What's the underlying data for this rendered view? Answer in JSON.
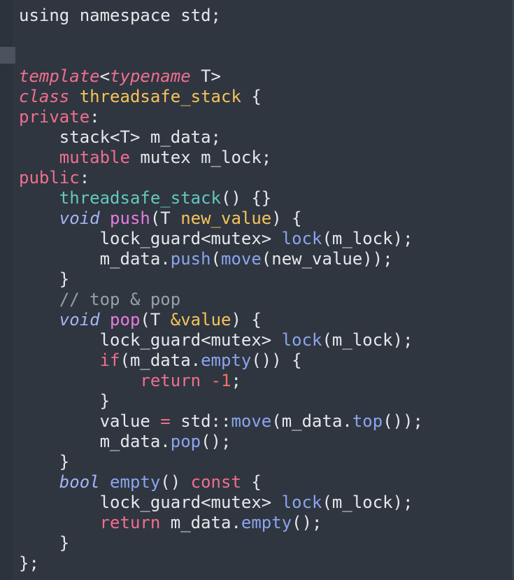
{
  "editor": {
    "colors": {
      "background": "#2f3640",
      "plain": "#e6e8ea",
      "keyword": "#f06f8d",
      "type": "#a5b5f7",
      "entity": "#f6c35a",
      "constructor": "#63c9bd",
      "function": "#e97be0",
      "method": "#8ca4ef",
      "number": "#ff6f5e",
      "comment": "#97a0aa"
    },
    "lines": [
      [
        {
          "t": "using namespace std;",
          "c": "plain"
        }
      ],
      [],
      [],
      [
        {
          "t": "template",
          "c": "storage"
        },
        {
          "t": "<",
          "c": "plain"
        },
        {
          "t": "typename",
          "c": "storage"
        },
        {
          "t": " T>",
          "c": "plain"
        }
      ],
      [
        {
          "t": "class",
          "c": "storage"
        },
        {
          "t": " ",
          "c": "plain"
        },
        {
          "t": "threadsafe_stack",
          "c": "entity"
        },
        {
          "t": " {",
          "c": "plain"
        }
      ],
      [
        {
          "t": "private",
          "c": "keyword"
        },
        {
          "t": ":",
          "c": "plain"
        }
      ],
      [
        {
          "t": "    stack<T> m_data;",
          "c": "plain"
        }
      ],
      [
        {
          "t": "    ",
          "c": "plain"
        },
        {
          "t": "mutable",
          "c": "keyword"
        },
        {
          "t": " mutex m_lock;",
          "c": "plain"
        }
      ],
      [
        {
          "t": "public",
          "c": "keyword"
        },
        {
          "t": ":",
          "c": "plain"
        }
      ],
      [
        {
          "t": "    ",
          "c": "plain"
        },
        {
          "t": "threadsafe_stack",
          "c": "constructor"
        },
        {
          "t": "() {}",
          "c": "plain"
        }
      ],
      [
        {
          "t": "    ",
          "c": "plain"
        },
        {
          "t": "void",
          "c": "type"
        },
        {
          "t": " ",
          "c": "plain"
        },
        {
          "t": "push",
          "c": "function"
        },
        {
          "t": "(T ",
          "c": "plain"
        },
        {
          "t": "new_value",
          "c": "param"
        },
        {
          "t": ") {",
          "c": "plain"
        }
      ],
      [
        {
          "t": "        lock_guard<mutex> ",
          "c": "plain"
        },
        {
          "t": "lock",
          "c": "method"
        },
        {
          "t": "(m_lock);",
          "c": "plain"
        }
      ],
      [
        {
          "t": "        m_data.",
          "c": "plain"
        },
        {
          "t": "push",
          "c": "method"
        },
        {
          "t": "(",
          "c": "plain"
        },
        {
          "t": "move",
          "c": "method"
        },
        {
          "t": "(new_value));",
          "c": "plain"
        }
      ],
      [
        {
          "t": "    }",
          "c": "plain"
        }
      ],
      [
        {
          "t": "    // top & pop",
          "c": "comment"
        }
      ],
      [
        {
          "t": "    ",
          "c": "plain"
        },
        {
          "t": "void",
          "c": "type"
        },
        {
          "t": " ",
          "c": "plain"
        },
        {
          "t": "pop",
          "c": "function"
        },
        {
          "t": "(T ",
          "c": "plain"
        },
        {
          "t": "&value",
          "c": "param"
        },
        {
          "t": ") {",
          "c": "plain"
        }
      ],
      [
        {
          "t": "        lock_guard<mutex> ",
          "c": "plain"
        },
        {
          "t": "lock",
          "c": "method"
        },
        {
          "t": "(m_lock);",
          "c": "plain"
        }
      ],
      [
        {
          "t": "        ",
          "c": "plain"
        },
        {
          "t": "if",
          "c": "keyword"
        },
        {
          "t": "(m_data.",
          "c": "plain"
        },
        {
          "t": "empty",
          "c": "method"
        },
        {
          "t": "()) {",
          "c": "plain"
        }
      ],
      [
        {
          "t": "            ",
          "c": "plain"
        },
        {
          "t": "return",
          "c": "keyword"
        },
        {
          "t": " ",
          "c": "plain"
        },
        {
          "t": "-1",
          "c": "number"
        },
        {
          "t": ";",
          "c": "plain"
        }
      ],
      [
        {
          "t": "        }",
          "c": "plain"
        }
      ],
      [
        {
          "t": "        value ",
          "c": "plain"
        },
        {
          "t": "=",
          "c": "keyword"
        },
        {
          "t": " std::",
          "c": "plain"
        },
        {
          "t": "move",
          "c": "method"
        },
        {
          "t": "(m_data.",
          "c": "plain"
        },
        {
          "t": "top",
          "c": "method"
        },
        {
          "t": "());",
          "c": "plain"
        }
      ],
      [
        {
          "t": "        m_data.",
          "c": "plain"
        },
        {
          "t": "pop",
          "c": "method"
        },
        {
          "t": "();",
          "c": "plain"
        }
      ],
      [
        {
          "t": "    }",
          "c": "plain"
        }
      ],
      [
        {
          "t": "    ",
          "c": "plain"
        },
        {
          "t": "bool",
          "c": "type"
        },
        {
          "t": " ",
          "c": "plain"
        },
        {
          "t": "empty",
          "c": "method"
        },
        {
          "t": "() ",
          "c": "plain"
        },
        {
          "t": "const",
          "c": "keyword"
        },
        {
          "t": " {",
          "c": "plain"
        }
      ],
      [
        {
          "t": "        lock_guard<mutex> ",
          "c": "plain"
        },
        {
          "t": "lock",
          "c": "method"
        },
        {
          "t": "(m_lock);",
          "c": "plain"
        }
      ],
      [
        {
          "t": "        ",
          "c": "plain"
        },
        {
          "t": "return",
          "c": "keyword"
        },
        {
          "t": " m_data.",
          "c": "plain"
        },
        {
          "t": "empty",
          "c": "method"
        },
        {
          "t": "();",
          "c": "plain"
        }
      ],
      [
        {
          "t": "    }",
          "c": "plain"
        }
      ],
      [
        {
          "t": "};",
          "c": "plain"
        }
      ]
    ]
  }
}
